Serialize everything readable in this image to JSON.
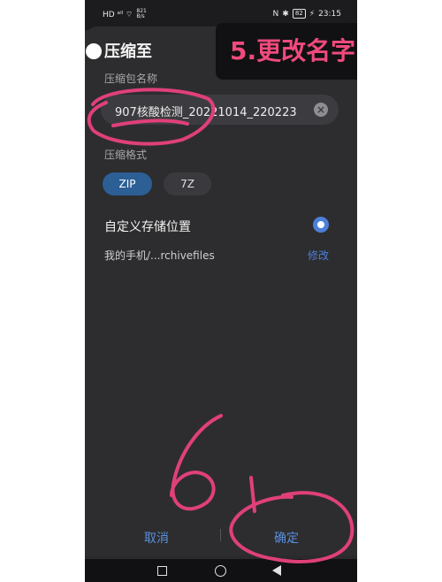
{
  "status_bar": {
    "left_icons": "HD ᵃˡˡ ⌔",
    "net_speed_top": "821",
    "net_speed_bottom": "B/s",
    "nfc": "N",
    "bluetooth": "✱",
    "battery": "82",
    "charging": "⚡",
    "time": "23:15"
  },
  "dialog": {
    "title": "压缩至",
    "name_label": "压缩包名称",
    "name_value": "907核酸检测_20221014_220223",
    "format_label": "压缩格式",
    "formats": [
      {
        "label": "ZIP",
        "selected": true
      },
      {
        "label": "7Z",
        "selected": false
      }
    ],
    "custom_location_title": "自定义存储位置",
    "custom_location_enabled": true,
    "path": "我的手机/...rchivefiles",
    "modify_label": "修改",
    "cancel_label": "取消",
    "confirm_label": "确定"
  },
  "annotation": {
    "step_text": "5.更改名字",
    "step_color": "#f04a7d",
    "handwritten_number": "6"
  },
  "colors": {
    "accent": "#4d7fd8",
    "chip_selected": "#2b5f96",
    "background": "#2d2d2f",
    "annotation_pink": "#e0407a"
  },
  "icons": {
    "clear": "×",
    "nav_recent": "square-icon",
    "nav_home": "circle-icon",
    "nav_back": "triangle-back-icon"
  }
}
